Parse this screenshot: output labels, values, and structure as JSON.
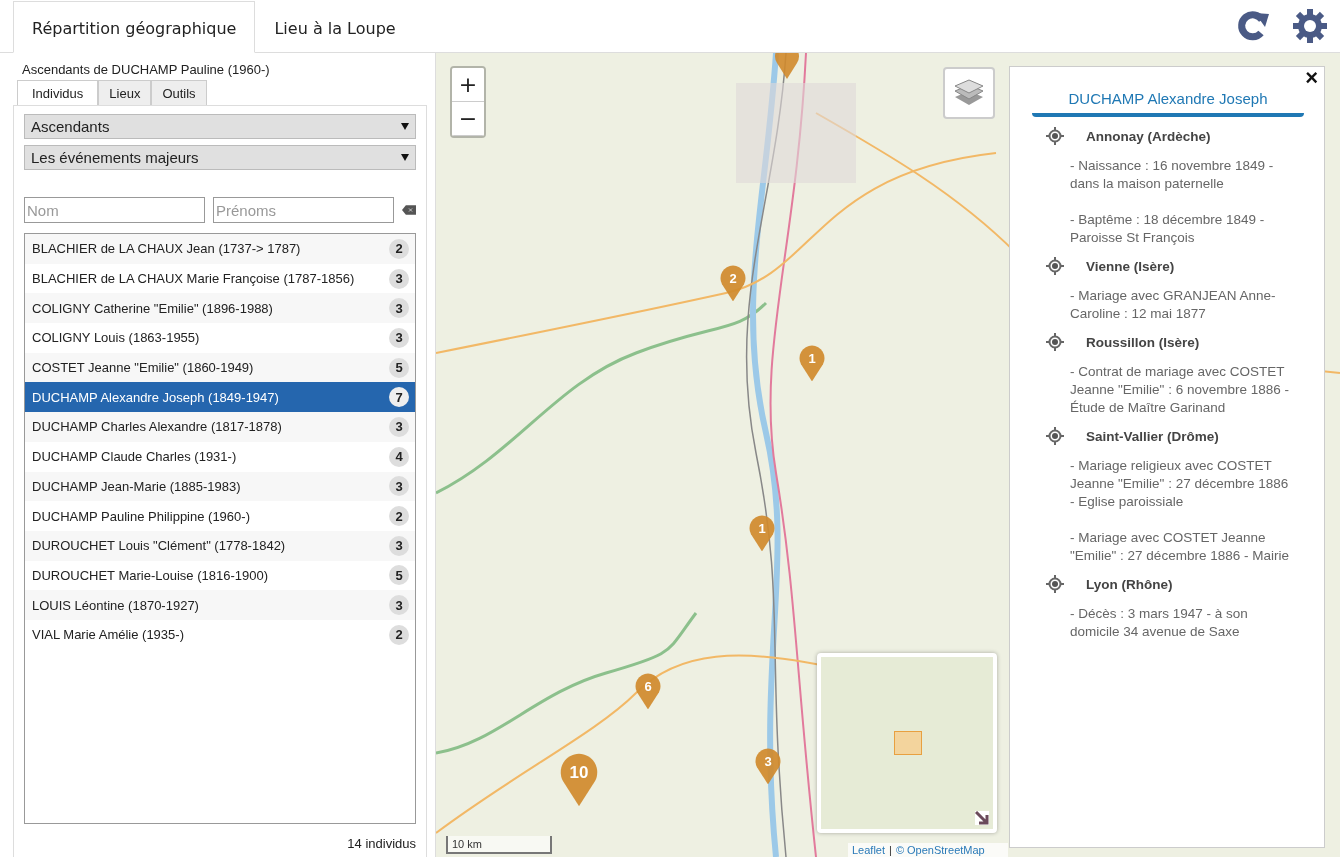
{
  "tabs": [
    {
      "label": "Répartition géographique",
      "selected": true
    },
    {
      "label": "Lieu à la Loupe",
      "selected": false
    }
  ],
  "sidebar": {
    "title": "Ascendants de DUCHAMP Pauline (1960-)",
    "tabs": [
      {
        "label": "Individus",
        "selected": true
      },
      {
        "label": "Lieux",
        "selected": false
      },
      {
        "label": "Outils",
        "selected": false
      }
    ],
    "selects": [
      "Ascendants",
      "Les événements majeurs"
    ],
    "fields": [
      {
        "placeholder": "Nom"
      },
      {
        "placeholder": "Prénoms"
      }
    ],
    "items": [
      {
        "name": "BLACHIER de LA CHAUX Jean (1737-> 1787)",
        "count": "2",
        "selected": false
      },
      {
        "name": "BLACHIER de LA CHAUX Marie Françoise (1787-1856)",
        "count": "3",
        "selected": false
      },
      {
        "name": "COLIGNY Catherine \"Emilie\" (1896-1988)",
        "count": "3",
        "selected": false
      },
      {
        "name": "COLIGNY Louis (1863-1955)",
        "count": "3",
        "selected": false
      },
      {
        "name": "COSTET Jeanne \"Emilie\" (1860-1949)",
        "count": "5",
        "selected": false
      },
      {
        "name": "DUCHAMP Alexandre Joseph (1849-1947)",
        "count": "7",
        "selected": true
      },
      {
        "name": "DUCHAMP Charles Alexandre (1817-1878)",
        "count": "3",
        "selected": false
      },
      {
        "name": "DUCHAMP Claude Charles (1931-)",
        "count": "4",
        "selected": false
      },
      {
        "name": "DUCHAMP Jean-Marie (1885-1983)",
        "count": "3",
        "selected": false
      },
      {
        "name": "DUCHAMP Pauline Philippine (1960-)",
        "count": "2",
        "selected": false
      },
      {
        "name": "DUROUCHET Louis \"Clément\" (1778-1842)",
        "count": "3",
        "selected": false
      },
      {
        "name": "DUROUCHET Marie-Louise (1816-1900)",
        "count": "5",
        "selected": false
      },
      {
        "name": "LOUIS Léontine (1870-1927)",
        "count": "3",
        "selected": false
      },
      {
        "name": "VIAL Marie Amélie (1935-)",
        "count": "2",
        "selected": false
      }
    ],
    "footer": "14 individus"
  },
  "map": {
    "zoom_buttons": [
      "+",
      "−"
    ],
    "markers": [
      {
        "count": "2"
      },
      {
        "count": "1"
      },
      {
        "count": "1"
      },
      {
        "count": "6"
      },
      {
        "count": "10"
      },
      {
        "count": "3"
      }
    ],
    "scale": "10 km",
    "attribution": {
      "links": [
        "Leaflet",
        "© OpenStreetMap"
      ],
      "separator": "|"
    },
    "popup": {
      "close": "×",
      "title": "DUCHAMP Alexandre Joseph",
      "places": [
        {
          "name": "Annonay (Ardèche)",
          "events": [
            "- Naissance : 16 novembre 1849 - dans la maison paternelle",
            "- Baptême : 18 décembre 1849 - Paroisse St François"
          ]
        },
        {
          "name": "Vienne (Isère)",
          "events": [
            "- Mariage avec GRANJEAN Anne-Caroline : 12 mai 1877"
          ]
        },
        {
          "name": "Roussillon (Isère)",
          "events": [
            "- Contrat de mariage avec COSTET Jeanne \"Emilie\" : 6 novembre 1886 - Étude de Maître Garinand"
          ]
        },
        {
          "name": "Saint-Vallier (Drôme)",
          "events": [
            "- Mariage religieux avec COSTET Jeanne \"Emilie\" : 27 décembre 1886 - Eglise paroissiale",
            "- Mariage avec COSTET Jeanne \"Emilie\" : 27 décembre 1886 - Mairie"
          ]
        },
        {
          "name": "Lyon (Rhône)",
          "events": [
            "- Décès : 3 mars 1947 - à son domicile 34 avenue de Saxe"
          ]
        }
      ]
    }
  }
}
